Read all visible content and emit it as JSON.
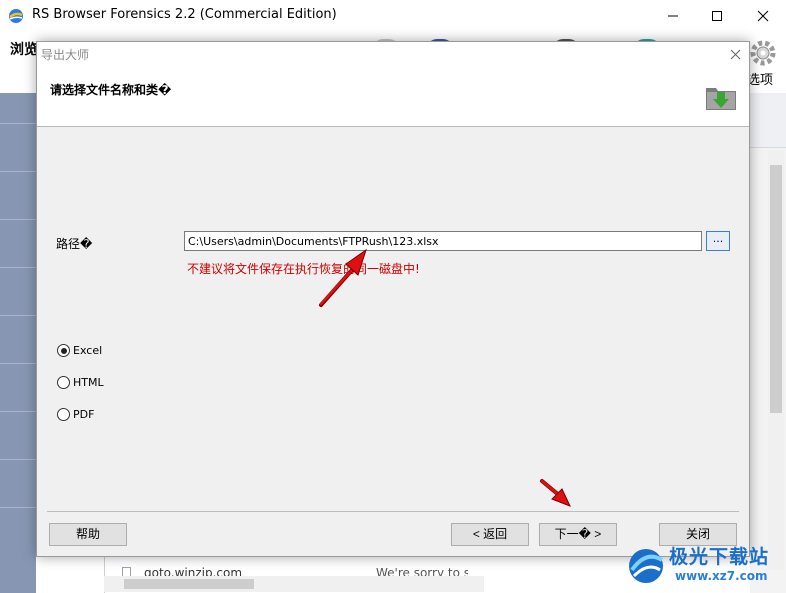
{
  "app": {
    "title": "RS Browser Forensics 2.2 (Commercial Edition)",
    "toolbar_left_label": "浏览器",
    "options_label": "选项"
  },
  "dialog": {
    "title": "导出大师",
    "heading": "请选择文件名称和类�",
    "path_label": "路径�",
    "path_value": "C:\\Users\\admin\\Documents\\FTPRush\\123.xlsx",
    "browse_label": "...",
    "warning": "不建议将文件保存在执行恢复的同一磁盘中!",
    "formats": [
      {
        "label": "Excel",
        "checked": true
      },
      {
        "label": "HTML",
        "checked": false
      },
      {
        "label": "PDF",
        "checked": false
      }
    ],
    "buttons": {
      "help": "帮助",
      "back": "< 返回",
      "next": "下一� >",
      "close": "关闭"
    }
  },
  "background_list": {
    "url": "goto.winzip.com",
    "message": "We're sorry to se"
  },
  "watermark": {
    "main": "极光下载站",
    "sub": "www.xz7.com"
  },
  "colors": {
    "warning": "#d00000",
    "annotation_arrow": "#e01010",
    "watermark": "#1b6fc9",
    "left_panel": "#8797b3"
  }
}
